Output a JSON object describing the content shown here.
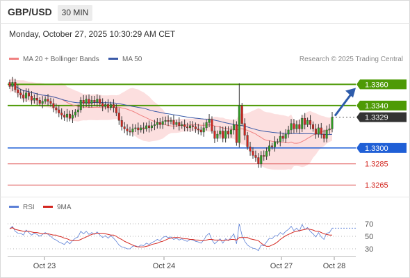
{
  "header": {
    "symbol": "GBP/USD",
    "timeframe": "30 MIN",
    "datetime": "Monday, October 27, 2025 10:30:29 AM CET"
  },
  "legend": {
    "ma20_label": "MA 20 + Bollinger Bands",
    "ma50_label": "MA 50",
    "research": "Research © 2025 Trading Central",
    "rsi_label": "RSI",
    "rsi_ma_label": "9MA"
  },
  "colors": {
    "up": "#2f9e24",
    "down": "#d3261f",
    "resistance": "#4e9a06",
    "pivot": "#1f5fd6",
    "support": "#e05a5a",
    "ma20": "#f08080",
    "ma50": "#3a5aa8",
    "bands": "#fbd9d9",
    "arrow": "#2e5cab"
  },
  "chart_data": [
    {
      "type": "candlestick",
      "x_ticks": [
        "Oct 23",
        "Oct 24",
        "Oct 27",
        "Oct 28"
      ],
      "levels": [
        {
          "value": 1.336,
          "label": "1.3360",
          "kind": "resistance"
        },
        {
          "value": 1.334,
          "label": "1.3340",
          "kind": "resistance"
        },
        {
          "value": 1.3329,
          "label": "1.3329",
          "kind": "last"
        },
        {
          "value": 1.33,
          "label": "1.3300",
          "kind": "pivot"
        },
        {
          "value": 1.3285,
          "label": "1.3285",
          "kind": "support"
        },
        {
          "value": 1.3265,
          "label": "1.3265",
          "kind": "support"
        }
      ],
      "ylim": [
        1.3254,
        1.3376
      ],
      "series": [
        {
          "name": "MA 20 + Bollinger Bands"
        },
        {
          "name": "MA 50"
        }
      ],
      "closes": [
        1.3358,
        1.3362,
        1.3355,
        1.3352,
        1.335,
        1.3347,
        1.3352,
        1.3349,
        1.3345,
        1.3347,
        1.3345,
        1.3342,
        1.3344,
        1.3346,
        1.3344,
        1.3342,
        1.3338,
        1.3336,
        1.3333,
        1.3331,
        1.3329,
        1.3332,
        1.3328,
        1.3331,
        1.3334,
        1.3336,
        1.3345,
        1.3342,
        1.3346,
        1.3342,
        1.3345,
        1.3343,
        1.3346,
        1.3342,
        1.3339,
        1.3341,
        1.3338,
        1.3341,
        1.3338,
        1.3333,
        1.3326,
        1.332,
        1.3318,
        1.3316,
        1.3315,
        1.3318,
        1.3319,
        1.3317,
        1.3319,
        1.3318,
        1.3321,
        1.3319,
        1.3321,
        1.3322,
        1.3324,
        1.3322,
        1.3325,
        1.3326,
        1.3325,
        1.3326,
        1.3322,
        1.3324,
        1.3321,
        1.3322,
        1.332,
        1.3319,
        1.3321,
        1.332,
        1.3318,
        1.3317,
        1.3315,
        1.3319,
        1.3324,
        1.3327,
        1.3316,
        1.3309,
        1.3313,
        1.3316,
        1.3309,
        1.3316,
        1.3313,
        1.3317,
        1.3322,
        1.3305,
        1.334,
        1.3323,
        1.3312,
        1.3301,
        1.3297,
        1.3293,
        1.3291,
        1.3285,
        1.3293,
        1.3292,
        1.3297,
        1.3302,
        1.3301,
        1.3306,
        1.3306,
        1.3311,
        1.3309,
        1.3313,
        1.3317,
        1.3323,
        1.3318,
        1.3322,
        1.3318,
        1.3328,
        1.3322,
        1.3326,
        1.3322,
        1.3318,
        1.3313,
        1.3319,
        1.3313,
        1.3309,
        1.3317,
        1.3318,
        1.3329
      ]
    },
    {
      "type": "line",
      "title": "RSI",
      "y_ticks": [
        70,
        50,
        30
      ],
      "ylim": [
        20,
        80
      ],
      "series": [
        {
          "name": "RSI",
          "values": [
            62,
            66,
            58,
            55,
            55,
            52,
            60,
            56,
            52,
            55,
            53,
            50,
            53,
            56,
            53,
            50,
            46,
            44,
            41,
            39,
            37,
            42,
            38,
            43,
            47,
            49,
            58,
            54,
            58,
            53,
            56,
            53,
            57,
            52,
            48,
            51,
            47,
            51,
            47,
            42,
            36,
            33,
            32,
            30,
            30,
            34,
            35,
            33,
            36,
            35,
            39,
            37,
            40,
            42,
            45,
            43,
            48,
            50,
            48,
            49,
            45,
            47,
            44,
            46,
            43,
            42,
            45,
            44,
            42,
            41,
            39,
            44,
            51,
            55,
            44,
            38,
            42,
            46,
            39,
            46,
            43,
            48,
            54,
            38,
            70,
            52,
            42,
            36,
            33,
            31,
            30,
            27,
            36,
            35,
            41,
            47,
            46,
            51,
            51,
            56,
            53,
            58,
            61,
            66,
            59,
            63,
            58,
            69,
            61,
            64,
            58,
            54,
            49,
            56,
            49,
            45,
            55,
            56,
            63
          ]
        },
        {
          "name": "9MA",
          "values": [
            62,
            64,
            61,
            60,
            59,
            58,
            58,
            58,
            57,
            56,
            56,
            55,
            54,
            54,
            54,
            53,
            52,
            52,
            50,
            49,
            47,
            46,
            44,
            43,
            43,
            43,
            45,
            47,
            49,
            51,
            53,
            54,
            55,
            55,
            55,
            54,
            53,
            52,
            52,
            50,
            47,
            45,
            42,
            40,
            38,
            36,
            34,
            33,
            33,
            33,
            34,
            35,
            37,
            38,
            39,
            41,
            42,
            44,
            46,
            47,
            48,
            48,
            48,
            47,
            46,
            46,
            45,
            45,
            44,
            44,
            43,
            43,
            44,
            45,
            45,
            44,
            44,
            44,
            43,
            44,
            44,
            45,
            45,
            44,
            48,
            48,
            48,
            48,
            46,
            45,
            44,
            43,
            39,
            36,
            34,
            34,
            36,
            38,
            41,
            45,
            48,
            51,
            53,
            55,
            57,
            58,
            59,
            60,
            61,
            62,
            61,
            60,
            58,
            58,
            56,
            54,
            53,
            52,
            52
          ]
        }
      ]
    }
  ]
}
